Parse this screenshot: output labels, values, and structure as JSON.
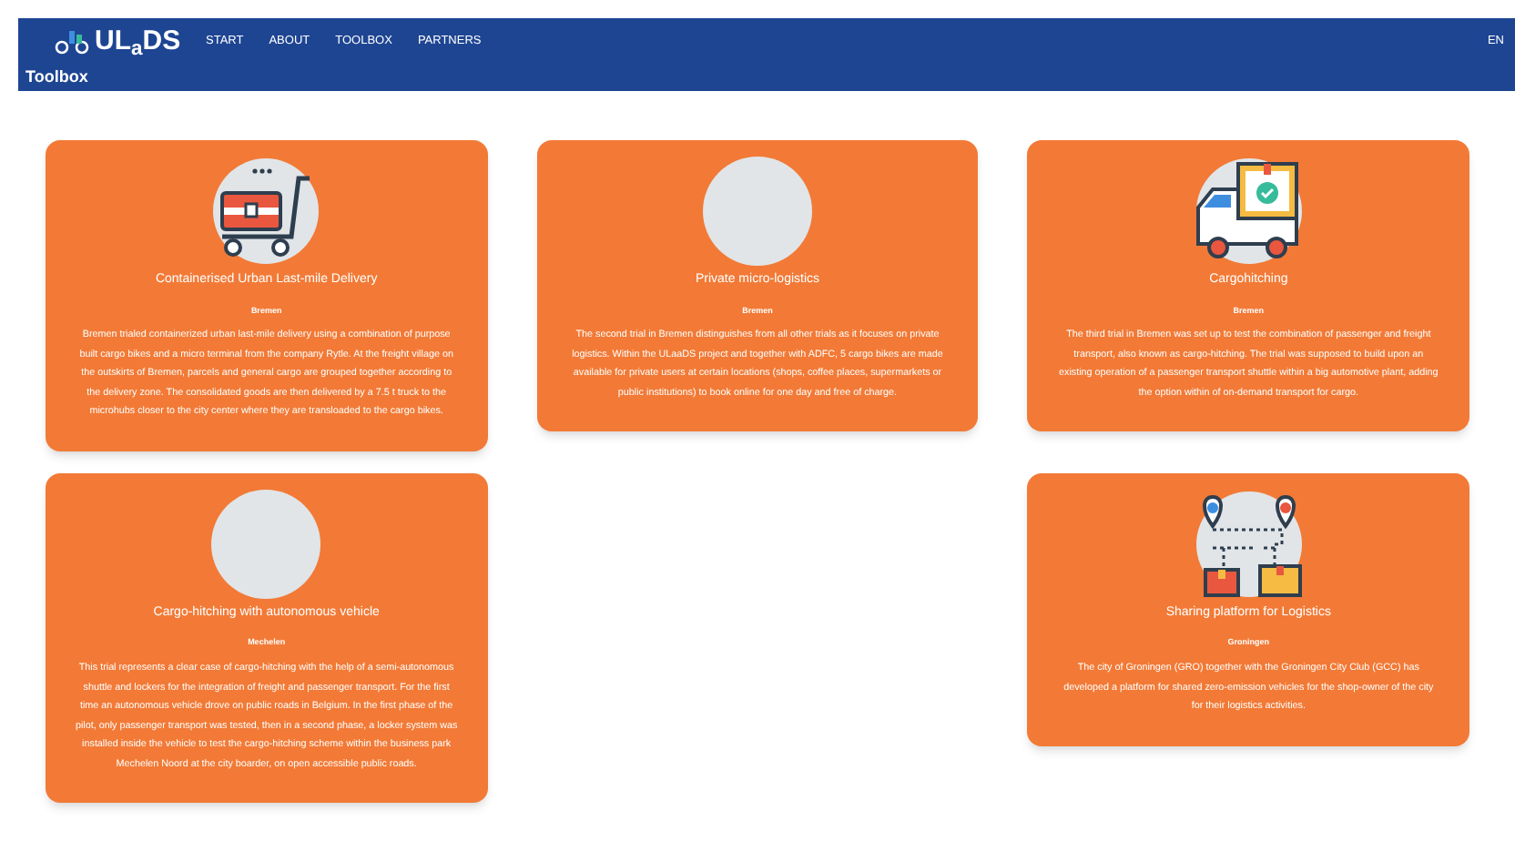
{
  "header": {
    "logo": "UL$_{a}$DS",
    "nav": [
      {
        "label": "START"
      },
      {
        "label": "ABOUT"
      },
      {
        "label": "TOOLBOX"
      },
      {
        "label": "PARTNERS"
      }
    ],
    "language": "EN",
    "page_title": "Toolbox"
  },
  "rows": [
    {
      "cards": [
        {
          "kind": "card",
          "title": "Containerised Urban Last-mile Delivery",
          "location": "Bremen",
          "text": "Bremen trialed containerized urban last-mile delivery using a combination of purpose built cargo bikes and a micro terminal from the company Rytle. At the freight village on the outskirts of Bremen, parcels and general cargo are grouped together according to the delivery zone. The consolidated goods are then delivered by a 7.5 t truck to the microhubs closer to the city center where they are transloaded to the cargo bikes."
        },
        {
          "kind": "card",
          "title": "Private micro-logistics",
          "location": "Bremen",
          "text": "The second trial in Bremen distinguishes from all other trials as it focuses on private logistics. Within the ULaaDS project and together with ADFC, 5 cargo bikes are made available for private users at certain locations (shops, coffee places, supermarkets or public institutions) to book online for one day and free of charge."
        },
        {
          "kind": "card",
          "title": "Cargohitching",
          "location": "Bremen",
          "text": "The third trial in Bremen was set up to test the combination of passenger and freight transport, also known as cargo-hitching. The trial was supposed to build upon an existing operation of a passenger transport shuttle within a big automotive plant, adding the option within of on-demand transport for cargo."
        }
      ]
    },
    {
      "cards": [
        {
          "kind": "card",
          "title": "Cargo-hitching with autonomous vehicle",
          "location": "Mechelen",
          "text": "This trial represents a clear case of cargo-hitching with the help of a semi-autonomous shuttle and lockers for the integration of freight and passenger transport. For the first time an autonomous vehicle drove on public roads in Belgium. In the first phase of the pilot, only passenger transport was tested, then in a second phase, a locker system was installed inside the vehicle to test the cargo-hitching scheme within the business park Mechelen Noord at the city boarder, on open accessible public roads."
        },
        {
          "kind": "empty"
        },
        {
          "kind": "card",
          "title": "Sharing platform for Logistics",
          "location": "Groningen",
          "text": "The city of Groningen (GRO) together with the Groningen City Club (GCC) has developed a platform for shared zero-emission vehicles for the shop-owner of the city for their logistics activities."
        }
      ]
    }
  ]
}
